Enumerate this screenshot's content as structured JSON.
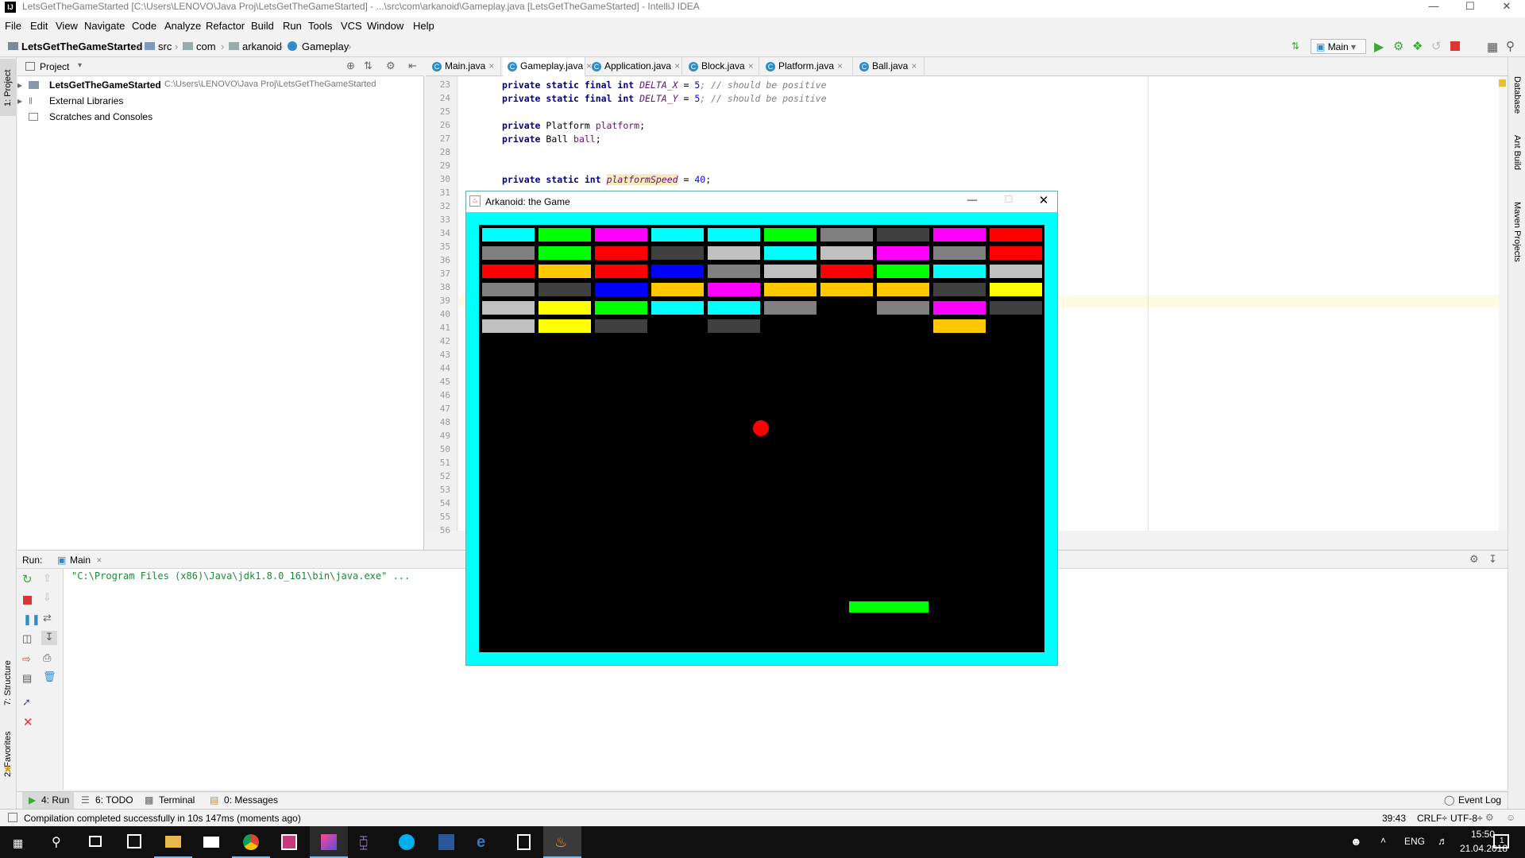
{
  "window": {
    "title": "LetsGetTheGameStarted [C:\\Users\\LENOVO\\Java Proj\\LetsGetTheGameStarted] - ...\\src\\com\\arkanoid\\Gameplay.java [LetsGetTheGameStarted] - IntelliJ IDEA"
  },
  "menu": [
    "File",
    "Edit",
    "View",
    "Navigate",
    "Code",
    "Analyze",
    "Refactor",
    "Build",
    "Run",
    "Tools",
    "VCS",
    "Window",
    "Help"
  ],
  "breadcrumb": {
    "project": "LetsGetTheGameStarted",
    "src": "src",
    "com": "com",
    "arkanoid": "arkanoid",
    "file": "Gameplay"
  },
  "run_config": "Main",
  "project_panel": {
    "header": "Project",
    "tool_label": "1: Project",
    "root_name": "LetsGetTheGameStarted",
    "root_path": "C:\\Users\\LENOVO\\Java Proj\\LetsGetTheGameStarted",
    "external": "External Libraries",
    "scratches": "Scratches and Consoles"
  },
  "editor_tabs": [
    "Main.java",
    "Gameplay.java",
    "Application.java",
    "Block.java",
    "Platform.java",
    "Ball.java"
  ],
  "gutter_lines": [
    "23",
    "24",
    "25",
    "26",
    "27",
    "28",
    "29",
    "30",
    "31",
    "32",
    "33",
    "34",
    "35",
    "36",
    "37",
    "38",
    "39",
    "40",
    "41",
    "42",
    "43",
    "44",
    "45",
    "46",
    "47",
    "48",
    "49",
    "50",
    "51",
    "52",
    "53",
    "54",
    "55",
    "56"
  ],
  "code": {
    "l23_a": "private static final int ",
    "l23_b": "DELTA_X",
    "l23_c": " = ",
    "l23_d": "5",
    "l23_e": "; // should be positive",
    "l24_a": "private static final int ",
    "l24_b": "DELTA_Y",
    "l24_c": " = ",
    "l24_d": "5",
    "l24_e": "; // should be positive",
    "l26_a": "private ",
    "l26_b": "Platform ",
    "l26_c": "platform",
    "l26_d": ";",
    "l27_a": "private ",
    "l27_b": "Ball ",
    "l27_c": "ball",
    "l27_d": ";",
    "l30_a": "private static int ",
    "l30_b": "platformSpeed",
    "l30_c": " = ",
    "l30_d": "40",
    "l30_e": ";"
  },
  "right_tools": [
    "Database",
    "Ant Build",
    "Maven Projects"
  ],
  "left_tools_bottom": [
    "7: Structure",
    "2: Favorites"
  ],
  "run_panel": {
    "label": "Run:",
    "config": "Main",
    "console_line": "\"C:\\Program Files (x86)\\Java\\jdk1.8.0_161\\bin\\java.exe\" ..."
  },
  "bottom_tabs": [
    "4: Run",
    "6: TODO",
    "Terminal",
    "0: Messages"
  ],
  "event_log": "Event Log",
  "status": {
    "message": "Compilation completed successfully in 10s 147ms (moments ago)",
    "position": "39:43",
    "line_sep": "CRLF÷",
    "encoding": "UTF-8÷"
  },
  "game": {
    "title": "Arkanoid: the Game",
    "colors": {
      "cyan": "#00ffff",
      "green": "#00ff00",
      "magenta": "#ff00ff",
      "gray": "#808080",
      "darkgray": "#404040",
      "red": "#ff0000",
      "lightgray": "#c0c0c0",
      "orange": "#ffc800",
      "blue": "#0000ff",
      "yellow": "#ffff00"
    },
    "bricks": [
      [
        "cyan",
        "green",
        "magenta",
        "cyan",
        "cyan",
        "green",
        "gray",
        "darkgray",
        "magenta",
        "red"
      ],
      [
        "gray",
        "green",
        "red",
        "darkgray",
        "lightgray",
        "cyan",
        "lightgray",
        "magenta",
        "gray",
        "red"
      ],
      [
        "red",
        "orange",
        "red",
        "blue",
        "gray",
        "lightgray",
        "red",
        "green",
        "cyan",
        "lightgray"
      ],
      [
        "gray",
        "darkgray",
        "blue",
        "orange",
        "magenta",
        "orange",
        "orange",
        "orange",
        "darkgray",
        "yellow"
      ],
      [
        "lightgray",
        "yellow",
        "green",
        "cyan",
        "cyan",
        "gray",
        "",
        "gray",
        "magenta",
        "darkgray"
      ],
      [
        "lightgray",
        "yellow",
        "darkgray",
        "",
        "darkgray",
        "",
        "",
        "",
        "orange",
        ""
      ]
    ],
    "ball_color": "#ff0000",
    "paddle_color": "#00ff00"
  },
  "taskbar": {
    "lang": "ENG",
    "time": "15:50",
    "date": "21.04.2018",
    "notif_count": "1"
  }
}
